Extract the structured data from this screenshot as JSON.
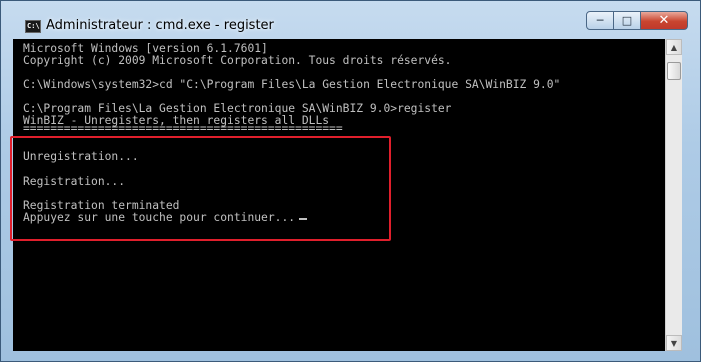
{
  "window": {
    "title": "Administrateur : cmd.exe - register",
    "icon_label": "C:\\",
    "buttons": {
      "minimize": "─",
      "maximize": "□",
      "close": "✕"
    }
  },
  "console": {
    "lines": [
      "Microsoft Windows [version 6.1.7601]",
      "Copyright (c) 2009 Microsoft Corporation. Tous droits réservés.",
      "",
      "C:\\Windows\\system32>cd \"C:\\Program Files\\La Gestion Electronique SA\\WinBIZ 9.0\"",
      "",
      "C:\\Program Files\\La Gestion Electronique SA\\WinBIZ 9.0>register",
      "WinBIZ - Unregisters, then registers all DLLs",
      "===============================================",
      "",
      "Unregistration...",
      "",
      "Registration...",
      "",
      "Registration terminated",
      "Appuyez sur une touche pour continuer..."
    ]
  },
  "scrollbar": {
    "up_arrow": "▲",
    "down_arrow": "▼"
  },
  "colors": {
    "highlight_border": "#e01f2c",
    "console_bg": "#000000",
    "console_text": "#c0c0c0"
  }
}
